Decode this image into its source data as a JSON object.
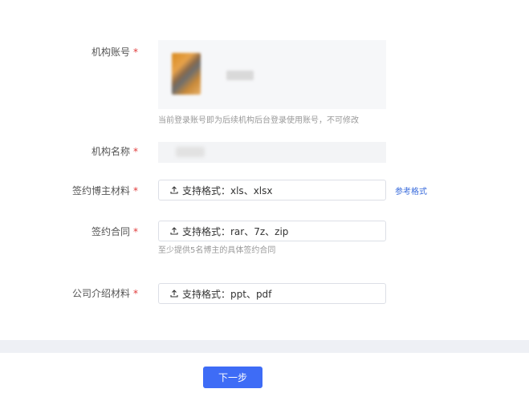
{
  "form": {
    "required_mark": "*",
    "account": {
      "label": "机构账号",
      "hint": "当前登录账号即为后续机构后台登录使用账号，不可修改"
    },
    "org_name": {
      "label": "机构名称"
    },
    "blogger_material": {
      "label": "签约博主材料",
      "upload_text": "支持格式：xls、xlsx",
      "reference_link": "参考格式"
    },
    "contract": {
      "label": "签约合同",
      "upload_text": "支持格式：rar、7z、zip",
      "hint": "至少提供5名博主的具体签约合同"
    },
    "company_intro": {
      "label": "公司介绍材料",
      "upload_text": "支持格式：ppt、pdf"
    }
  },
  "footer": {
    "next_button": "下一步"
  },
  "colors": {
    "primary": "#3e6cf6",
    "required": "#e03a3a",
    "link": "#3a6cdc"
  },
  "icons": [
    "upload-icon"
  ]
}
